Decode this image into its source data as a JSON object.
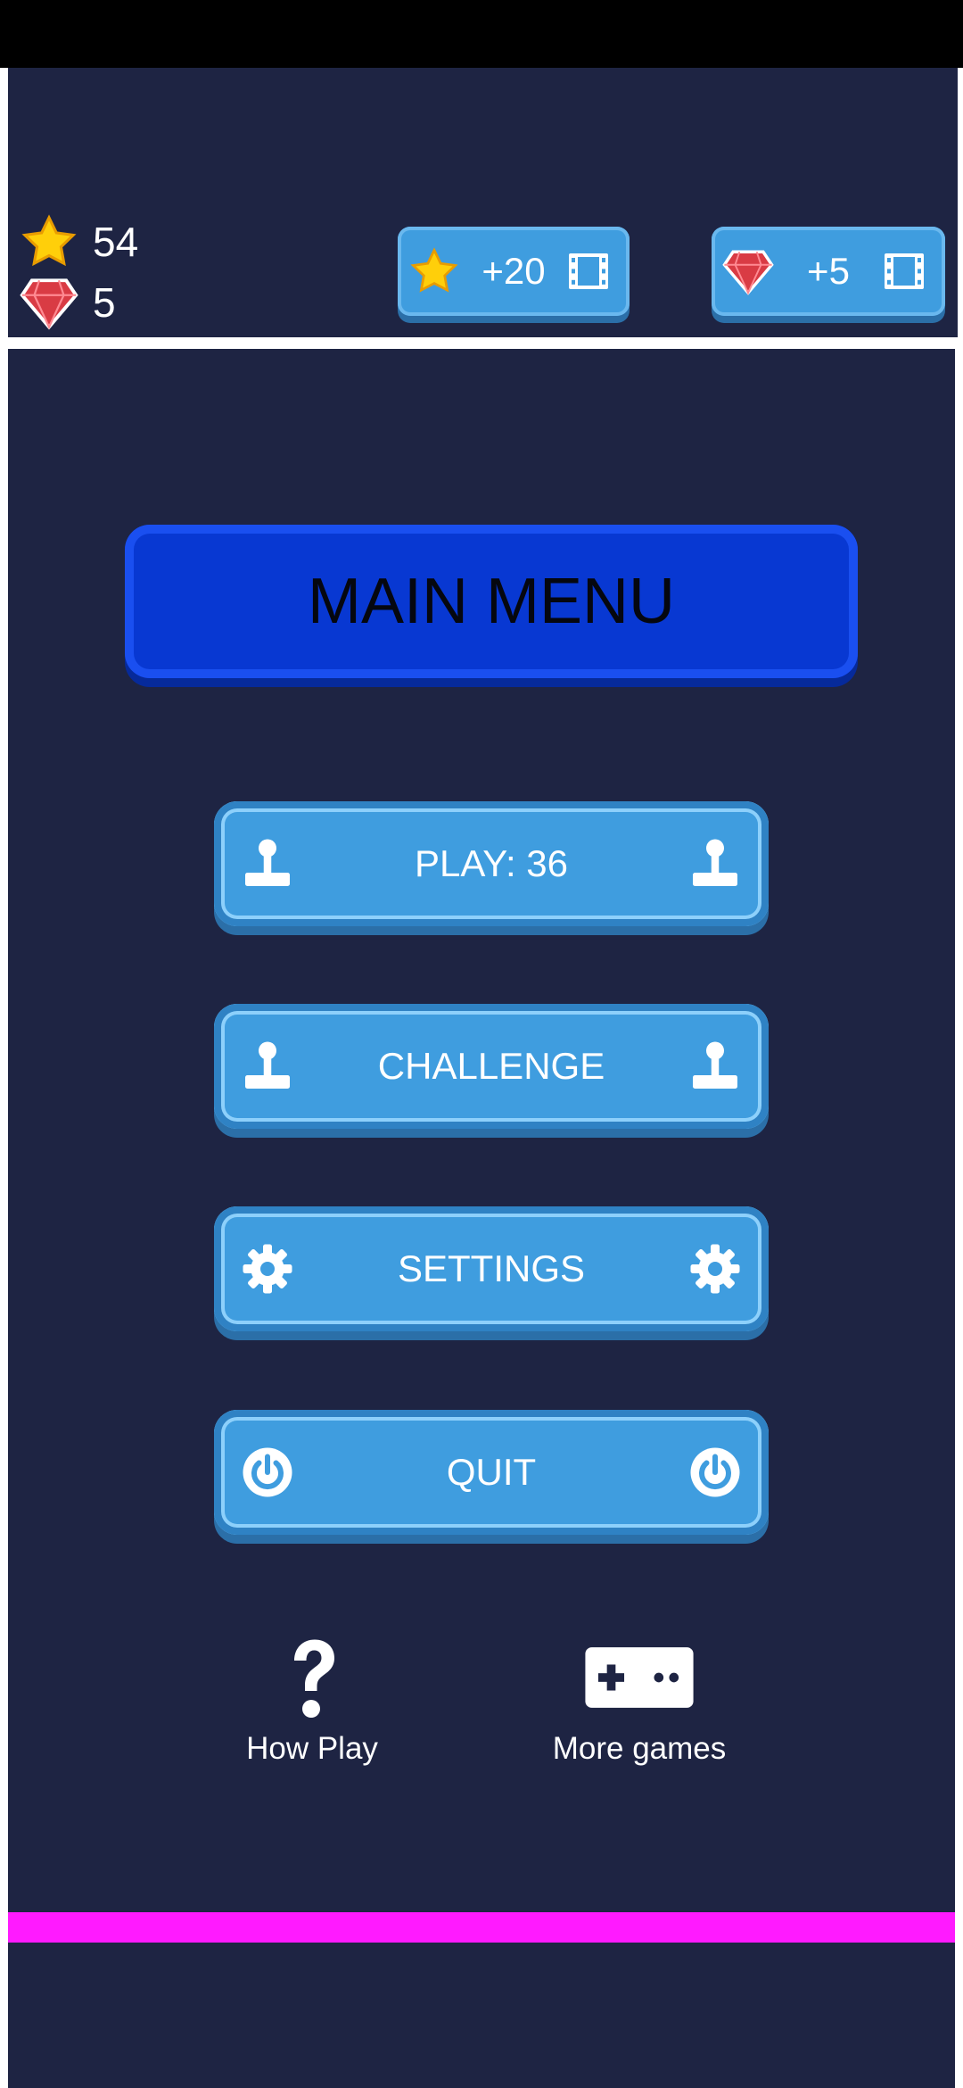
{
  "stats": {
    "stars": "54",
    "gems": "5"
  },
  "rewards": [
    {
      "label": "+20",
      "icon": "star-icon"
    },
    {
      "label": "+5",
      "icon": "gem-icon"
    }
  ],
  "title": "MAIN MENU",
  "menu": [
    {
      "label": "PLAY: 36",
      "icon": "joystick-icon"
    },
    {
      "label": "CHALLENGE",
      "icon": "joystick-icon"
    },
    {
      "label": "SETTINGS",
      "icon": "gear-icon"
    },
    {
      "label": "QUIT",
      "icon": "power-icon"
    }
  ],
  "bottom": {
    "how_play": "How Play",
    "more_games": "More games"
  },
  "colors": {
    "background": "#1e2443",
    "button": "#3f9ddf",
    "title_button": "#0838d2",
    "accent_bar": "#ff1aff"
  }
}
